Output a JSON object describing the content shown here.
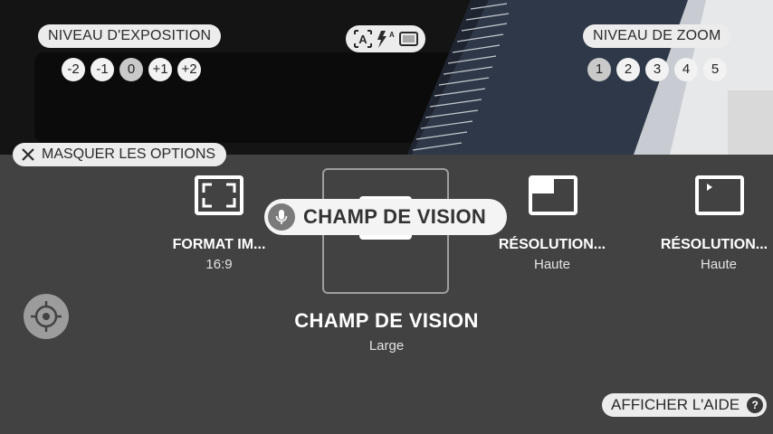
{
  "exposure": {
    "label": "NIVEAU D'EXPOSITION",
    "levels": [
      "-2",
      "-1",
      "0",
      "+1",
      "+2"
    ],
    "selected": "0"
  },
  "zoom": {
    "label": "NIVEAU DE ZOOM",
    "levels": [
      "1",
      "2",
      "3",
      "4",
      "5"
    ],
    "selected": "1"
  },
  "mode_icons": [
    "auto-text-icon",
    "flash-auto-icon",
    "frame-icon"
  ],
  "hide_options_label": "MASQUER LES OPTIONS",
  "options": [
    {
      "title": "FORMAT IM...",
      "value": "16:9",
      "icon": "aspect-ratio-icon"
    },
    {
      "title": "CHAMP DE VISION",
      "value": "Large",
      "icon": "field-of-view-icon",
      "selected": true
    },
    {
      "title": "RÉSOLUTION...",
      "value": "Haute",
      "icon": "photo-resolution-icon"
    },
    {
      "title": "RÉSOLUTION...",
      "value": "Haute",
      "icon": "video-resolution-icon"
    }
  ],
  "voice_tooltip": "CHAMP DE VISION",
  "help_label": "AFFICHER L'AIDE",
  "help_icon": "?",
  "colors": {
    "panel": "#424242",
    "pill": "#ececec",
    "selected_border": "#9e9e9e"
  }
}
